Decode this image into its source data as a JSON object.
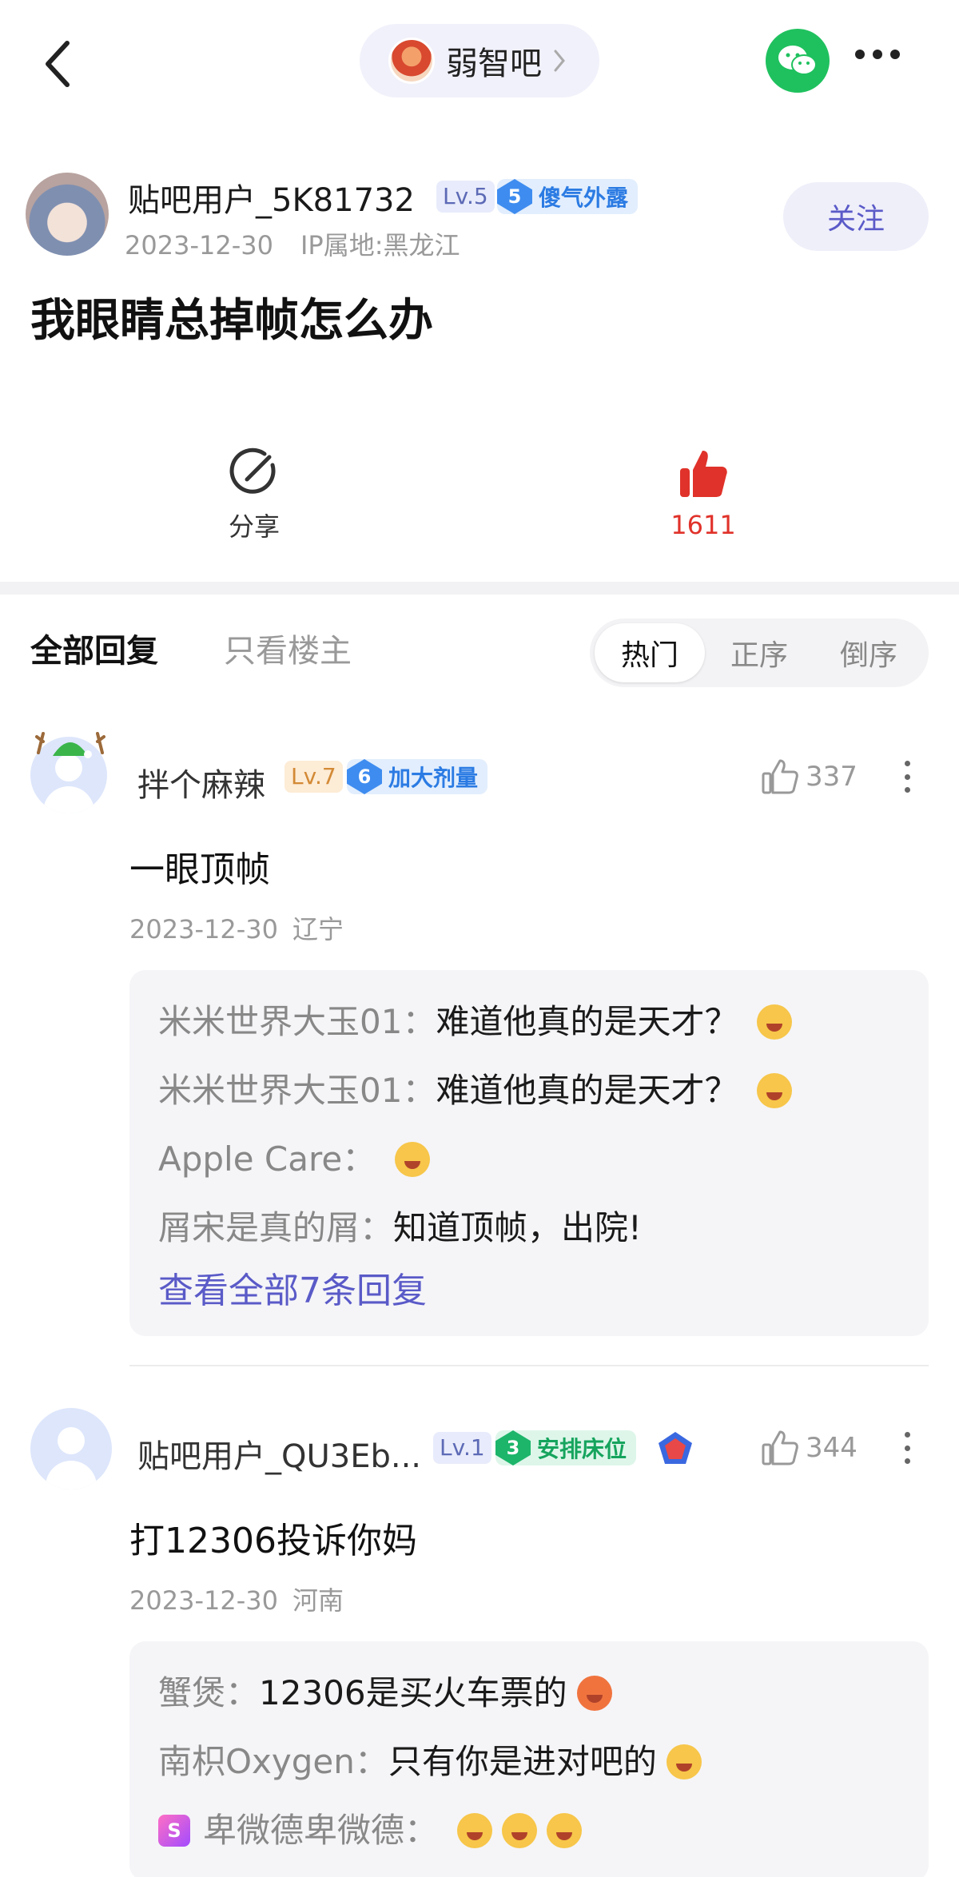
{
  "header": {
    "forum_name": "弱智吧"
  },
  "post": {
    "author": "贴吧用户_5K81732",
    "level": "Lv.5",
    "title_badge_num": "5",
    "title_badge": "傻气外露",
    "date": "2023-12-30",
    "ip": "IP属地:黑龙江",
    "follow_label": "关注",
    "title": "我眼睛总掉帧怎么办",
    "share_label": "分享",
    "like_count": "1611"
  },
  "tabs": {
    "all": "全部回复",
    "host": "只看楼主",
    "sort": [
      "热门",
      "正序",
      "倒序"
    ]
  },
  "comments": [
    {
      "name": "拌个麻辣",
      "level": "Lv.7",
      "badge_num": "6",
      "badge": "加大剂量",
      "likes": "337",
      "text": "一眼顶帧",
      "date": "2023-12-30",
      "location": "辽宁",
      "replies": [
        {
          "name": "米米世界大玉01：",
          "text": "难道他真的是天才？"
        },
        {
          "name": "米米世界大玉01：",
          "text": "难道他真的是天才？"
        },
        {
          "name": "Apple Care：",
          "text": ""
        },
        {
          "name": "屑宋是真的屑：",
          "text": "知道顶帧，出院!"
        }
      ],
      "view_all": "查看全部7条回复"
    },
    {
      "name": "贴吧用户_QU3Eb...",
      "level": "Lv.1",
      "badge_num": "3",
      "badge": "安排床位",
      "likes": "344",
      "text": "打12306投诉你妈",
      "date": "2023-12-30",
      "location": "河南",
      "replies": [
        {
          "name": "蟹煲：",
          "text": "12306是买火车票的"
        },
        {
          "name": "南枳Oxygen：",
          "text": "只有你是进对吧的"
        },
        {
          "name": "卑微德卑微德：",
          "text": ""
        }
      ]
    }
  ],
  "colors": {
    "accent": "#5a5ac8",
    "like_red": "#e0322a",
    "wechat_green": "#1fc15e"
  },
  "icons": [
    "back-chevron-icon",
    "forum-avatar",
    "chevron-right-icon",
    "wechat-icon",
    "more-icon",
    "share-icon",
    "thumb-up-filled-icon",
    "thumb-up-icon",
    "more-vertical-icon",
    "emoji-icon"
  ]
}
